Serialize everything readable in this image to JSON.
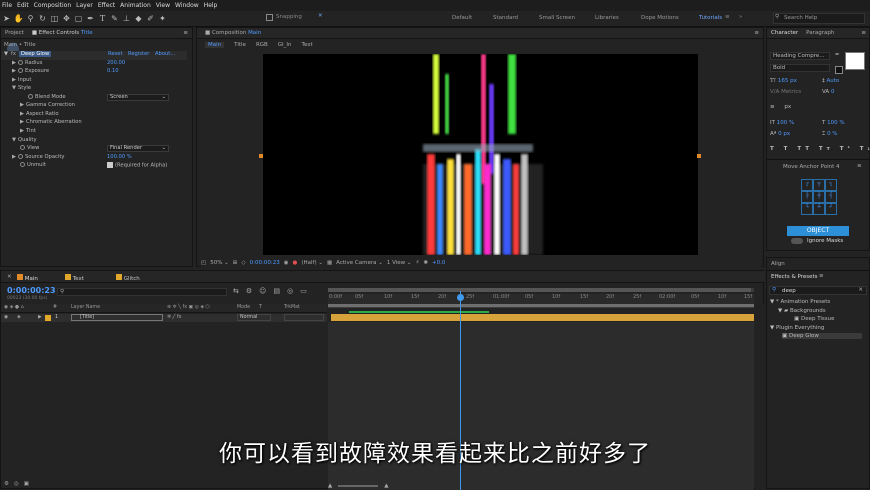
{
  "menu": [
    "File",
    "Edit",
    "Composition",
    "Layer",
    "Effect",
    "Animation",
    "View",
    "Window",
    "Help"
  ],
  "toolbar": {
    "snapping_label": "Snapping"
  },
  "workspaces": {
    "default": "Default",
    "standard": "Standard",
    "small_screen": "Small Screen",
    "libraries": "Libraries",
    "dope_motions": "Dope Motions",
    "tutorials": "Tutorials",
    "search_placeholder": "Search Help"
  },
  "left_panel": {
    "tab_project": "Project",
    "tab_effect_controls": "Effect Controls",
    "effect_controls_layer": "Title",
    "breadcrumb": "Main • Title",
    "effect_name": "Deep Glow",
    "reset": "Reset",
    "register": "Register",
    "about": "About...",
    "rows": [
      {
        "label": "Radius",
        "value": "200.00"
      },
      {
        "label": "Exposure",
        "value": "0.10"
      },
      {
        "label": "Input",
        "value": ""
      },
      {
        "label": "Style",
        "value": ""
      },
      {
        "label": "Blend Mode",
        "value": "Screen"
      },
      {
        "label": "Gamma Correction",
        "value": ""
      },
      {
        "label": "Aspect Ratio",
        "value": ""
      },
      {
        "label": "Chromatic Aberration",
        "value": ""
      },
      {
        "label": "Tint",
        "value": ""
      },
      {
        "label": "Quality",
        "value": ""
      },
      {
        "label": "View",
        "value": "Final Render"
      },
      {
        "label": "Source Opacity",
        "value": "100.00 %"
      },
      {
        "label": "Unmult",
        "value": "(Required for Alpha)"
      }
    ]
  },
  "comp_panel": {
    "tab_label": "Composition",
    "tab_comp": "Main",
    "flow": [
      "Main",
      "Title",
      "RGB",
      "GI_In",
      "Text"
    ],
    "zoom": "50%",
    "timecode": "0:00:00:23",
    "resolution": "(Half)",
    "camera": "Active Camera",
    "view": "1 View",
    "exposure": "+0.0"
  },
  "right_panel": {
    "tab_character": "Character",
    "tab_paragraph": "Paragraph",
    "font": "Heading Compre...",
    "style": "Bold",
    "size": "165 px",
    "leading": "Auto",
    "kerning": "Metrics",
    "tracking": "0",
    "unit": "px",
    "vscale": "100 %",
    "hscale": "100 %",
    "baseline": "0 px",
    "tsume": "0 %",
    "move_anchor": "Move Anchor Point 4",
    "object_button": "OBJECT",
    "ignore_masks": "Ignore Masks",
    "align": "Align",
    "effects_presets": "Effects & Presets",
    "search_value": "deep",
    "tree": [
      {
        "label": "* Animation Presets",
        "level": 0
      },
      {
        "label": "Backgrounds",
        "level": 1
      },
      {
        "label": "Deep Tissue",
        "level": 2
      },
      {
        "label": "Plugin Everything",
        "level": 0
      },
      {
        "label": "Deep Glow",
        "level": 1
      }
    ]
  },
  "timeline": {
    "tabs": [
      "Main",
      "Text",
      "Glitch"
    ],
    "timecode": "0:00:00:23",
    "fps": "00023 (30.00 fps)",
    "col_layer_name": "Layer Name",
    "col_mode": "Mode",
    "col_trkmat": "TrkMat",
    "layer_index": "1",
    "layer_name": "[Title]",
    "layer_mode": "Normal",
    "ruler": [
      "0:00f",
      "05f",
      "10f",
      "15f",
      "20f",
      "25f",
      "01:00f",
      "05f",
      "10f",
      "15f",
      "20f",
      "25f",
      "02:00f",
      "05f",
      "10f",
      "15f"
    ]
  },
  "subtitle": "你可以看到故障效果看起来比之前好多了",
  "colors": {
    "accent_blue": "#4f9bff",
    "work_area": "#d7a23a",
    "playhead": "#3f9bf0",
    "object_button": "#2d8fd6"
  }
}
